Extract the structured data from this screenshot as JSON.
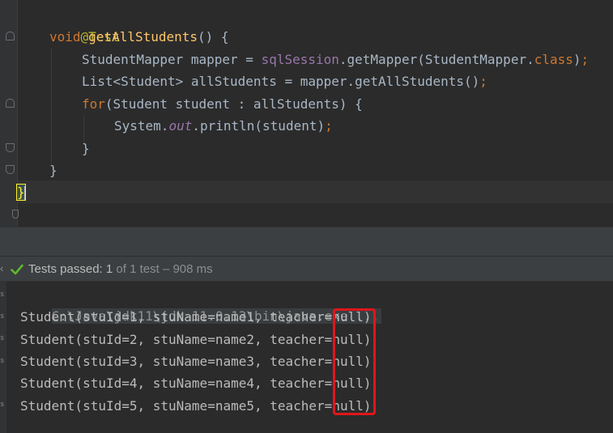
{
  "editor": {
    "lines": {
      "annotation": "@Test",
      "method_kw": "void",
      "method_name": "getAllStudents",
      "method_sig_rest": "() {",
      "l3_type": "StudentMapper mapper = ",
      "l3_field": "sqlSession",
      "l3_call": ".getMapper(StudentMapper.",
      "l3_kw": "class",
      "l3_end": ")",
      "l3_semi": ";",
      "l4_code": "List<Student> allStudents = mapper.getAllStudents()",
      "l4_semi": ";",
      "l5_kw": "for",
      "l5_rest": "(Student student : allStudents) {",
      "l6_sys": "System.",
      "l6_static": "out",
      "l6_rest": ".println(student)",
      "l6_semi": ";",
      "l7_brace": "}",
      "l8_brace": "}",
      "l9_brace": "}"
    }
  },
  "test_status": {
    "label": "Tests passed:",
    "count": "1",
    "detail": "of 1 test – 908 ms",
    "icon": "checkmark-icon",
    "color": "#5fb832"
  },
  "console": {
    "command": "C:\\Java\\jdk11\\jdk-11.0.13\\bin\\java.exe ...",
    "output": [
      "Student(stuId=1, stuName=name1, teacher=null)",
      "Student(stuId=2, stuName=name2, teacher=null)",
      "Student(stuId=3, stuName=name3, teacher=null)",
      "Student(stuId=4, stuName=name4, teacher=null)",
      "Student(stuId=5, stuName=name5, teacher=null)"
    ],
    "highlight_color": "#e0161c"
  }
}
